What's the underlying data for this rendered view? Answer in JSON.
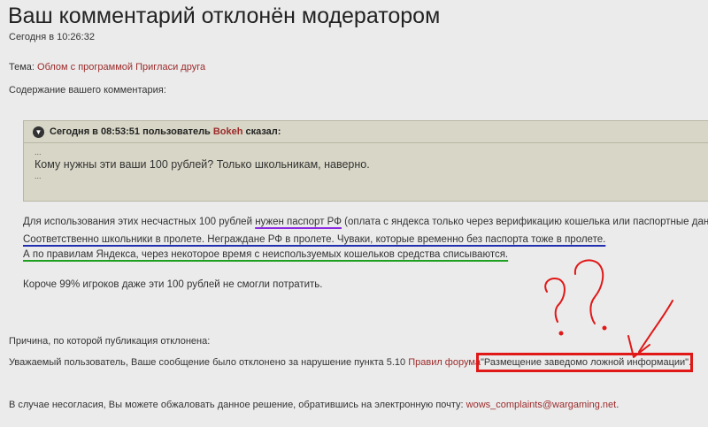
{
  "header": {
    "title": "Ваш комментарий отклонён модератором",
    "timestamp": "Сегодня в 10:26:32"
  },
  "topic": {
    "label": "Тема:",
    "link": "Облом с программой Пригласи друга"
  },
  "content_label": "Содержание вашего комментария:",
  "quote": {
    "prefix": "Сегодня в 08:53:51 пользователь",
    "author": "Bokeh",
    "suffix": "сказал:",
    "ellipsis_top": "...",
    "text": "Кому нужны эти ваши 100 рублей? Только школьникам, наверно.",
    "ellipsis_bottom": "..."
  },
  "comment": {
    "p1_a": "Для использования этих несчастных 100 рублей ",
    "p1_b": "нужен паспорт РФ",
    "p1_c": " (оплата с яндекса только через верификацию кошелька или паспортные данные).",
    "p2": "Соответственно школьники в пролете. Неграждане РФ в пролете. Чуваки, которые временно без паспорта тоже в пролете.",
    "p3": "А по правилам Яндекса, через некоторое время с неиспользуемых кошельков средства списываются.",
    "p4": "Короче 99% игроков даже эти 100 рублей не смогли потратить."
  },
  "reason": {
    "label": "Причина, по которой публикация отклонена:",
    "text": "Уважаемый пользователь, Ваше сообщение было отклонено за нарушение пункта 5.10 ",
    "rules_link": "Правил форума",
    "quote": "\"Размещение заведомо ложной информации\"",
    "end": "."
  },
  "complaint": {
    "text": "В случае несогласия, Вы можете обжаловать данное решение, обратившись на электронную почту: ",
    "email": "wows_complaints@wargaming.net",
    "end": "."
  },
  "colors": {
    "link": "#9c2b2b",
    "highlight_box": "#e01818",
    "underline_purple": "#8a2be2",
    "underline_blue": "#2030b0",
    "underline_green": "#20a020"
  }
}
